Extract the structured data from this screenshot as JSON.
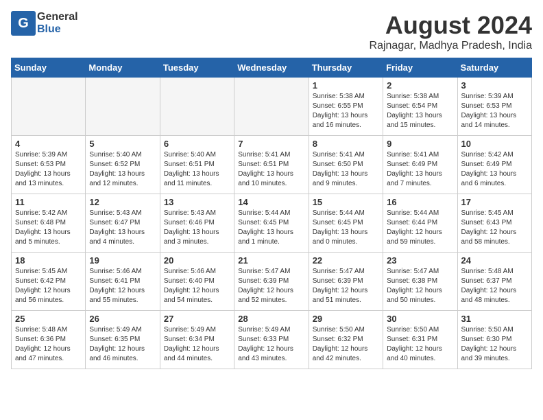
{
  "header": {
    "logo_general": "General",
    "logo_blue": "Blue",
    "title": "August 2024",
    "subtitle": "Rajnagar, Madhya Pradesh, India"
  },
  "days_of_week": [
    "Sunday",
    "Monday",
    "Tuesday",
    "Wednesday",
    "Thursday",
    "Friday",
    "Saturday"
  ],
  "weeks": [
    [
      {
        "day": "",
        "empty": true
      },
      {
        "day": "",
        "empty": true
      },
      {
        "day": "",
        "empty": true
      },
      {
        "day": "",
        "empty": true
      },
      {
        "day": "1",
        "line1": "Sunrise: 5:38 AM",
        "line2": "Sunset: 6:55 PM",
        "line3": "Daylight: 13 hours",
        "line4": "and 16 minutes."
      },
      {
        "day": "2",
        "line1": "Sunrise: 5:38 AM",
        "line2": "Sunset: 6:54 PM",
        "line3": "Daylight: 13 hours",
        "line4": "and 15 minutes."
      },
      {
        "day": "3",
        "line1": "Sunrise: 5:39 AM",
        "line2": "Sunset: 6:53 PM",
        "line3": "Daylight: 13 hours",
        "line4": "and 14 minutes."
      }
    ],
    [
      {
        "day": "4",
        "line1": "Sunrise: 5:39 AM",
        "line2": "Sunset: 6:53 PM",
        "line3": "Daylight: 13 hours",
        "line4": "and 13 minutes."
      },
      {
        "day": "5",
        "line1": "Sunrise: 5:40 AM",
        "line2": "Sunset: 6:52 PM",
        "line3": "Daylight: 13 hours",
        "line4": "and 12 minutes."
      },
      {
        "day": "6",
        "line1": "Sunrise: 5:40 AM",
        "line2": "Sunset: 6:51 PM",
        "line3": "Daylight: 13 hours",
        "line4": "and 11 minutes."
      },
      {
        "day": "7",
        "line1": "Sunrise: 5:41 AM",
        "line2": "Sunset: 6:51 PM",
        "line3": "Daylight: 13 hours",
        "line4": "and 10 minutes."
      },
      {
        "day": "8",
        "line1": "Sunrise: 5:41 AM",
        "line2": "Sunset: 6:50 PM",
        "line3": "Daylight: 13 hours",
        "line4": "and 9 minutes."
      },
      {
        "day": "9",
        "line1": "Sunrise: 5:41 AM",
        "line2": "Sunset: 6:49 PM",
        "line3": "Daylight: 13 hours",
        "line4": "and 7 minutes."
      },
      {
        "day": "10",
        "line1": "Sunrise: 5:42 AM",
        "line2": "Sunset: 6:49 PM",
        "line3": "Daylight: 13 hours",
        "line4": "and 6 minutes."
      }
    ],
    [
      {
        "day": "11",
        "line1": "Sunrise: 5:42 AM",
        "line2": "Sunset: 6:48 PM",
        "line3": "Daylight: 13 hours",
        "line4": "and 5 minutes."
      },
      {
        "day": "12",
        "line1": "Sunrise: 5:43 AM",
        "line2": "Sunset: 6:47 PM",
        "line3": "Daylight: 13 hours",
        "line4": "and 4 minutes."
      },
      {
        "day": "13",
        "line1": "Sunrise: 5:43 AM",
        "line2": "Sunset: 6:46 PM",
        "line3": "Daylight: 13 hours",
        "line4": "and 3 minutes."
      },
      {
        "day": "14",
        "line1": "Sunrise: 5:44 AM",
        "line2": "Sunset: 6:45 PM",
        "line3": "Daylight: 13 hours",
        "line4": "and 1 minute."
      },
      {
        "day": "15",
        "line1": "Sunrise: 5:44 AM",
        "line2": "Sunset: 6:45 PM",
        "line3": "Daylight: 13 hours",
        "line4": "and 0 minutes."
      },
      {
        "day": "16",
        "line1": "Sunrise: 5:44 AM",
        "line2": "Sunset: 6:44 PM",
        "line3": "Daylight: 12 hours",
        "line4": "and 59 minutes."
      },
      {
        "day": "17",
        "line1": "Sunrise: 5:45 AM",
        "line2": "Sunset: 6:43 PM",
        "line3": "Daylight: 12 hours",
        "line4": "and 58 minutes."
      }
    ],
    [
      {
        "day": "18",
        "line1": "Sunrise: 5:45 AM",
        "line2": "Sunset: 6:42 PM",
        "line3": "Daylight: 12 hours",
        "line4": "and 56 minutes."
      },
      {
        "day": "19",
        "line1": "Sunrise: 5:46 AM",
        "line2": "Sunset: 6:41 PM",
        "line3": "Daylight: 12 hours",
        "line4": "and 55 minutes."
      },
      {
        "day": "20",
        "line1": "Sunrise: 5:46 AM",
        "line2": "Sunset: 6:40 PM",
        "line3": "Daylight: 12 hours",
        "line4": "and 54 minutes."
      },
      {
        "day": "21",
        "line1": "Sunrise: 5:47 AM",
        "line2": "Sunset: 6:39 PM",
        "line3": "Daylight: 12 hours",
        "line4": "and 52 minutes."
      },
      {
        "day": "22",
        "line1": "Sunrise: 5:47 AM",
        "line2": "Sunset: 6:39 PM",
        "line3": "Daylight: 12 hours",
        "line4": "and 51 minutes."
      },
      {
        "day": "23",
        "line1": "Sunrise: 5:47 AM",
        "line2": "Sunset: 6:38 PM",
        "line3": "Daylight: 12 hours",
        "line4": "and 50 minutes."
      },
      {
        "day": "24",
        "line1": "Sunrise: 5:48 AM",
        "line2": "Sunset: 6:37 PM",
        "line3": "Daylight: 12 hours",
        "line4": "and 48 minutes."
      }
    ],
    [
      {
        "day": "25",
        "line1": "Sunrise: 5:48 AM",
        "line2": "Sunset: 6:36 PM",
        "line3": "Daylight: 12 hours",
        "line4": "and 47 minutes."
      },
      {
        "day": "26",
        "line1": "Sunrise: 5:49 AM",
        "line2": "Sunset: 6:35 PM",
        "line3": "Daylight: 12 hours",
        "line4": "and 46 minutes."
      },
      {
        "day": "27",
        "line1": "Sunrise: 5:49 AM",
        "line2": "Sunset: 6:34 PM",
        "line3": "Daylight: 12 hours",
        "line4": "and 44 minutes."
      },
      {
        "day": "28",
        "line1": "Sunrise: 5:49 AM",
        "line2": "Sunset: 6:33 PM",
        "line3": "Daylight: 12 hours",
        "line4": "and 43 minutes."
      },
      {
        "day": "29",
        "line1": "Sunrise: 5:50 AM",
        "line2": "Sunset: 6:32 PM",
        "line3": "Daylight: 12 hours",
        "line4": "and 42 minutes."
      },
      {
        "day": "30",
        "line1": "Sunrise: 5:50 AM",
        "line2": "Sunset: 6:31 PM",
        "line3": "Daylight: 12 hours",
        "line4": "and 40 minutes."
      },
      {
        "day": "31",
        "line1": "Sunrise: 5:50 AM",
        "line2": "Sunset: 6:30 PM",
        "line3": "Daylight: 12 hours",
        "line4": "and 39 minutes."
      }
    ]
  ]
}
